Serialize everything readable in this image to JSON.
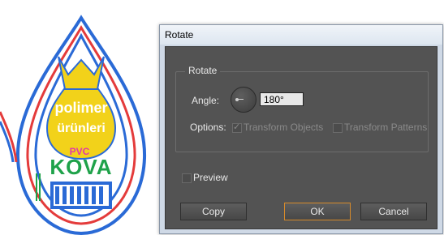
{
  "background_artwork": {
    "logo_lines": [
      "polimer",
      "ürünleri"
    ],
    "pvc": "PVC",
    "brand": "KOVA",
    "colors": {
      "accent_yellow": "#f2d21a",
      "stroke_red": "#e43b3b",
      "stroke_blue": "#2a6ad6",
      "brand_green": "#1fa24a",
      "pvc_pink": "#e23aa9"
    }
  },
  "dialog": {
    "title": "Rotate",
    "group_label": "Rotate",
    "angle_label": "Angle:",
    "angle_value": "180°",
    "options_label": "Options:",
    "transform_objects_label": "Transform Objects",
    "transform_patterns_label": "Transform Patterns",
    "preview_label": "Preview",
    "copy_label": "Copy",
    "ok_label": "OK",
    "cancel_label": "Cancel"
  }
}
